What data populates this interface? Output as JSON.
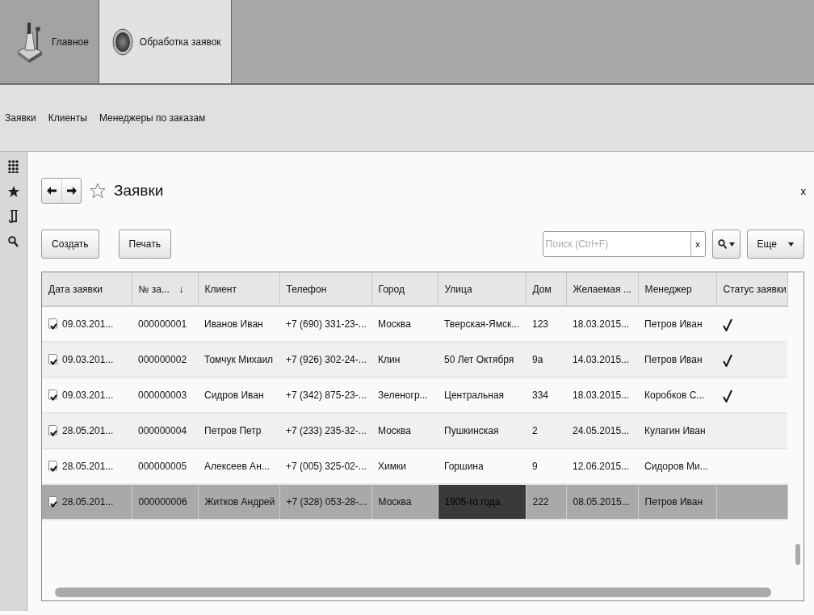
{
  "sections": [
    {
      "label": "Главное",
      "kind": "desk",
      "selected": false
    },
    {
      "label": "Обработка заявок",
      "kind": "ball",
      "selected": true
    }
  ],
  "nav_links": [
    "Заявки",
    "Клиенты",
    "Менеджеры по заказам"
  ],
  "form": {
    "title": "Заявки",
    "close": "x",
    "buttons": [
      "Создать",
      "Печать"
    ],
    "search": {
      "placeholder": "Поиск (Ctrl+F)",
      "clear": "x"
    },
    "more": "Еще"
  },
  "table": {
    "columns": [
      {
        "label": "Дата заявки",
        "current": false
      },
      {
        "label": "№ за...",
        "sort_arrow": "↓",
        "current": false
      },
      {
        "label": "Клиент",
        "current": false
      },
      {
        "label": "Телефон",
        "current": false
      },
      {
        "label": "Город",
        "current": false
      },
      {
        "label": "Улица",
        "current": true
      },
      {
        "label": "Дом",
        "current": false
      },
      {
        "label": "Желаемая ...",
        "current": false
      },
      {
        "label": "Менеджер",
        "current": false
      },
      {
        "label": "Статус заявки",
        "current": false
      }
    ],
    "rows": [
      {
        "cells": [
          "09.03.201...",
          "000000001",
          "Иванов Иван",
          "+7 (690) 331-23-...",
          "Москва",
          "Тверская-Ямск...",
          "123",
          "18.03.2015...",
          "Петров Иван"
        ],
        "done": true,
        "selected": false
      },
      {
        "cells": [
          "09.03.201...",
          "000000002",
          "Томчук Михаил",
          "+7 (926) 302-24-...",
          "Клин",
          "50 Лет Октября",
          "9а",
          "14.03.2015...",
          "Петров Иван"
        ],
        "done": true,
        "selected": false
      },
      {
        "cells": [
          "09.03.201...",
          "000000003",
          "Сидров Иван",
          "+7 (342) 875-23-...",
          "Зеленогр...",
          "Центральная",
          "334",
          "18.03.2015...",
          "Коробков С..."
        ],
        "done": true,
        "selected": false
      },
      {
        "cells": [
          "28.05.201...",
          "000000004",
          "Петров Петр",
          "+7 (233) 235-32-...",
          "Москва",
          "Пушкинская",
          "2",
          "24.05.2015...",
          "Кулагин Иван"
        ],
        "done": false,
        "selected": false
      },
      {
        "cells": [
          "28.05.201...",
          "000000005",
          "Алексеев Ан...",
          "+7 (005) 325-02-...",
          "Химки",
          "Горшина",
          "9",
          "12.06.2015...",
          "Сидоров Ми..."
        ],
        "done": false,
        "selected": false
      },
      {
        "cells": [
          "28.05.201...",
          "000000006",
          "Житков Андрей",
          "+7 (328) 053-28-...",
          "Москва",
          "1905-го года",
          "222",
          "08.05.2015...",
          "Петров Иван"
        ],
        "done": false,
        "selected": true
      }
    ]
  }
}
